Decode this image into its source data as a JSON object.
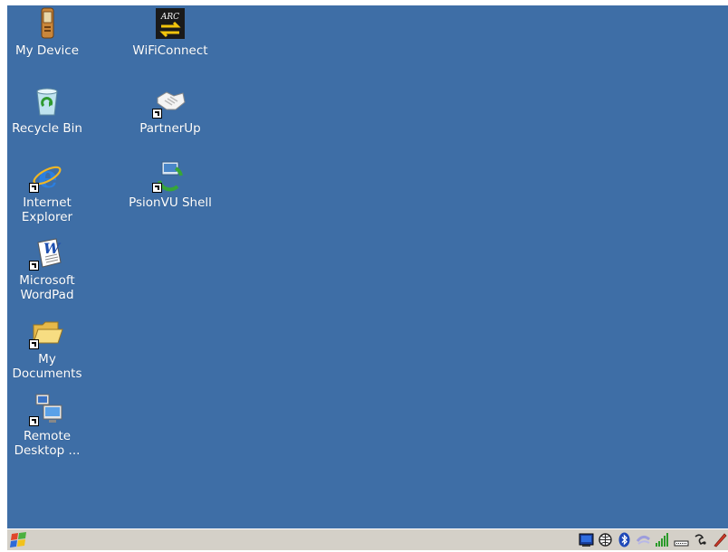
{
  "desktop": {
    "background": "#3e6ea6",
    "icons": [
      {
        "label": "My Device",
        "icon": "device-icon",
        "shortcut": false
      },
      {
        "label": "WiFiConnect",
        "icon": "wifi-connect-icon",
        "shortcut": false
      },
      {
        "label": "Recycle Bin",
        "icon": "recycle-bin-icon",
        "shortcut": false
      },
      {
        "label": "PartnerUp",
        "icon": "partner-handshake-icon",
        "shortcut": true
      },
      {
        "label": "Internet Explorer",
        "icon": "internet-explorer-icon",
        "shortcut": true
      },
      {
        "label": "PsionVU Shell",
        "icon": "psionvu-shell-icon",
        "shortcut": true
      },
      {
        "label": "Microsoft WordPad",
        "icon": "wordpad-icon",
        "shortcut": true
      },
      {
        "label": "My Documents",
        "icon": "folder-icon",
        "shortcut": true
      },
      {
        "label": "Remote Desktop ...",
        "icon": "remote-desktop-icon",
        "shortcut": true
      }
    ]
  },
  "taskbar": {
    "background": "#d4d0c8",
    "start_icon": "windows-flag-icon",
    "tray_icons": [
      "screen-icon",
      "network-globe-icon",
      "bluetooth-icon",
      "connection-icon",
      "signal-bars-icon",
      "battery-icon",
      "wireless-icon",
      "pen-icon"
    ]
  }
}
